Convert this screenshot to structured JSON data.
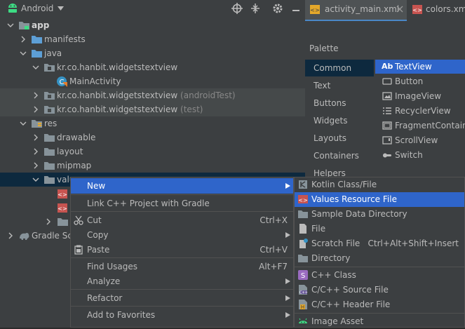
{
  "project": {
    "view_name": "Android",
    "tree": [
      {
        "label": "app",
        "bold": true
      },
      {
        "label": "manifests"
      },
      {
        "label": "java"
      },
      {
        "label": "kr.co.hanbit.widgetstextview"
      },
      {
        "label": "MainActivity"
      },
      {
        "label": "kr.co.hanbit.widgetstextview",
        "suffix": "(androidTest)"
      },
      {
        "label": "kr.co.hanbit.widgetstextview",
        "suffix": "(test)"
      },
      {
        "label": "res"
      },
      {
        "label": "drawable"
      },
      {
        "label": "layout"
      },
      {
        "label": "mipmap"
      },
      {
        "label": "valu"
      },
      {
        "label": "Gradle Scr"
      }
    ]
  },
  "tabs": [
    {
      "label": "activity_main.xml"
    },
    {
      "label": "colors.xml"
    }
  ],
  "palette": {
    "title": "Palette",
    "categories": [
      "Common",
      "Text",
      "Buttons",
      "Widgets",
      "Layouts",
      "Containers",
      "Helpers"
    ],
    "items": [
      {
        "label": "TextView",
        "icon": "Ab"
      },
      {
        "label": "Button"
      },
      {
        "label": "ImageView"
      },
      {
        "label": "RecyclerView"
      },
      {
        "label": "FragmentContaine"
      },
      {
        "label": "ScrollView"
      },
      {
        "label": "Switch"
      }
    ]
  },
  "context_menu": {
    "items": [
      {
        "label": "New",
        "submenu": true
      },
      {
        "label": "Link C++ Project with Gradle"
      },
      {
        "label": "Cut",
        "shortcut": "Ctrl+X"
      },
      {
        "label": "Copy",
        "submenu": true
      },
      {
        "label": "Paste",
        "shortcut": "Ctrl+V"
      },
      {
        "label": "Find Usages",
        "shortcut": "Alt+F7"
      },
      {
        "label": "Analyze",
        "submenu": true
      },
      {
        "label": "Refactor",
        "submenu": true
      },
      {
        "label": "Add to Favorites",
        "submenu": true
      }
    ]
  },
  "new_submenu": {
    "items": [
      {
        "label": "Kotlin Class/File"
      },
      {
        "label": "Values Resource File"
      },
      {
        "label": "Sample Data Directory"
      },
      {
        "label": "File"
      },
      {
        "label": "Scratch File",
        "shortcut": "Ctrl+Alt+Shift+Insert"
      },
      {
        "label": "Directory"
      },
      {
        "label": "C++ Class"
      },
      {
        "label": "C/C++ Source File"
      },
      {
        "label": "C/C++ Header File"
      },
      {
        "label": "Image Asset"
      }
    ]
  },
  "colors": {
    "selection": "#2f65ca",
    "folder": "#87939a",
    "res_folder": "#5d9fd6",
    "android_green": "#3ddc84"
  }
}
